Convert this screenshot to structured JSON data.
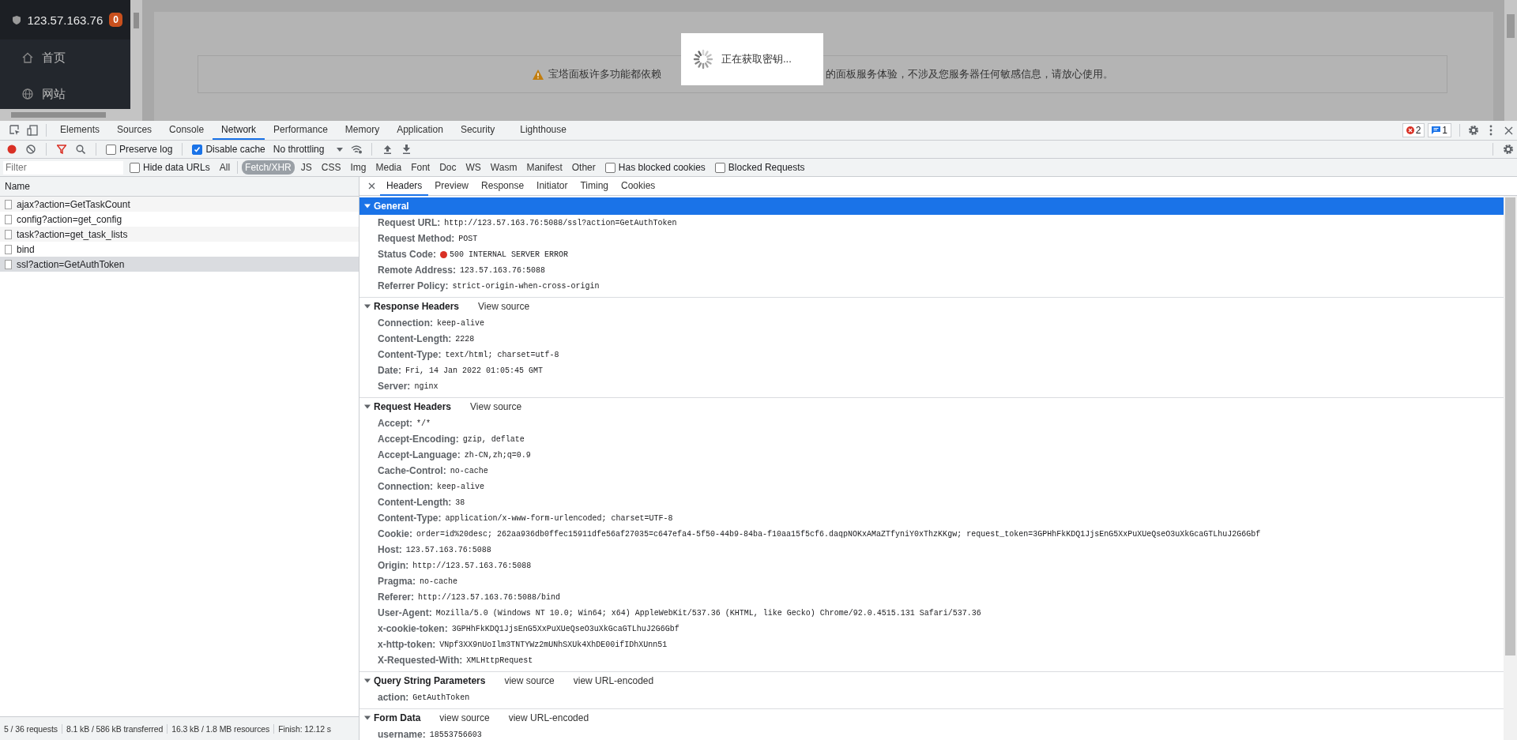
{
  "sidebar": {
    "host": "123.57.163.76",
    "badge": "0",
    "items": [
      {
        "label": "首页"
      },
      {
        "label": "网站"
      }
    ]
  },
  "notice": {
    "text_before": "宝塔面板许多功能都依赖",
    "text_after": "的面板服务体验，不涉及您服务器任何敏感信息，请放心使用。"
  },
  "loading_dialog": {
    "text": "正在获取密钥..."
  },
  "devtools": {
    "tabs": [
      {
        "label": "Elements",
        "selected": false
      },
      {
        "label": "Sources",
        "selected": false
      },
      {
        "label": "Console",
        "selected": false
      },
      {
        "label": "Network",
        "selected": true
      },
      {
        "label": "Performance",
        "selected": false
      },
      {
        "label": "Memory",
        "selected": false
      },
      {
        "label": "Application",
        "selected": false
      },
      {
        "label": "Security",
        "selected": false
      },
      {
        "label": "Lighthouse",
        "selected": false
      }
    ],
    "error_count": "2",
    "message_count": "1",
    "toolbar": {
      "recording": true,
      "filter_active": true,
      "preserve_log": {
        "label": "Preserve log",
        "checked": false
      },
      "disable_cache": {
        "label": "Disable cache",
        "checked": true
      },
      "throttling": "No throttling"
    },
    "filter_bar": {
      "placeholder": "Filter",
      "hide_data_urls": {
        "label": "Hide data URLs",
        "checked": false
      },
      "types": [
        {
          "label": "All",
          "selected": false
        },
        {
          "label": "Fetch/XHR",
          "selected": true
        },
        {
          "label": "JS",
          "selected": false
        },
        {
          "label": "CSS",
          "selected": false
        },
        {
          "label": "Img",
          "selected": false
        },
        {
          "label": "Media",
          "selected": false
        },
        {
          "label": "Font",
          "selected": false
        },
        {
          "label": "Doc",
          "selected": false
        },
        {
          "label": "WS",
          "selected": false
        },
        {
          "label": "Wasm",
          "selected": false
        },
        {
          "label": "Manifest",
          "selected": false
        },
        {
          "label": "Other",
          "selected": false
        }
      ],
      "has_blocked_cookies": {
        "label": "Has blocked cookies",
        "checked": false
      },
      "blocked_requests": {
        "label": "Blocked Requests",
        "checked": false
      }
    },
    "requests": {
      "column": "Name",
      "rows": [
        {
          "name": "ajax?action=GetTaskCount",
          "selected": false
        },
        {
          "name": "config?action=get_config",
          "selected": false
        },
        {
          "name": "task?action=get_task_lists",
          "selected": false
        },
        {
          "name": "bind",
          "selected": false
        },
        {
          "name": "ssl?action=GetAuthToken",
          "selected": true
        }
      ]
    },
    "detail_tabs": [
      {
        "label": "Headers",
        "selected": true
      },
      {
        "label": "Preview",
        "selected": false
      },
      {
        "label": "Response",
        "selected": false
      },
      {
        "label": "Initiator",
        "selected": false
      },
      {
        "label": "Timing",
        "selected": false
      },
      {
        "label": "Cookies",
        "selected": false
      }
    ],
    "sections": [
      {
        "title": "General",
        "expanded": true,
        "selected": true,
        "rows": [
          {
            "key": "Request URL:",
            "value": "http://123.57.163.76:5088/ssl?action=GetAuthToken",
            "kind": "text"
          },
          {
            "key": "Request Method:",
            "value": "POST",
            "kind": "text"
          },
          {
            "key": "Status Code:",
            "value": "500 INTERNAL SERVER ERROR",
            "kind": "error"
          },
          {
            "key": "Remote Address:",
            "value": "123.57.163.76:5088",
            "kind": "text"
          },
          {
            "key": "Referrer Policy:",
            "value": "strict-origin-when-cross-origin",
            "kind": "text"
          }
        ]
      },
      {
        "title": "Response Headers",
        "expanded": true,
        "selected": false,
        "links": [
          "View source"
        ],
        "rows": [
          {
            "key": "Connection:",
            "value": "keep-alive"
          },
          {
            "key": "Content-Length:",
            "value": "2228"
          },
          {
            "key": "Content-Type:",
            "value": "text/html; charset=utf-8"
          },
          {
            "key": "Date:",
            "value": "Fri, 14 Jan 2022 01:05:45 GMT"
          },
          {
            "key": "Server:",
            "value": "nginx"
          }
        ]
      },
      {
        "title": "Request Headers",
        "expanded": true,
        "selected": false,
        "links": [
          "View source"
        ],
        "rows": [
          {
            "key": "Accept:",
            "value": "*/*"
          },
          {
            "key": "Accept-Encoding:",
            "value": "gzip, deflate"
          },
          {
            "key": "Accept-Language:",
            "value": "zh-CN,zh;q=0.9"
          },
          {
            "key": "Cache-Control:",
            "value": "no-cache"
          },
          {
            "key": "Connection:",
            "value": "keep-alive"
          },
          {
            "key": "Content-Length:",
            "value": "38"
          },
          {
            "key": "Content-Type:",
            "value": "application/x-www-form-urlencoded; charset=UTF-8"
          },
          {
            "key": "Cookie:",
            "value": "order=id%20desc; 262aa936db0ffec15911dfe56af27035=c647efa4-5f50-44b9-84ba-f10aa15f5cf6.daqpNOKxAMaZTfyniY0xThzKKgw; request_token=3GPHhFkKDQ1JjsEnG5XxPuXUeQseO3uXkGcaGTLhuJ2G6Gbf"
          },
          {
            "key": "Host:",
            "value": "123.57.163.76:5088"
          },
          {
            "key": "Origin:",
            "value": "http://123.57.163.76:5088"
          },
          {
            "key": "Pragma:",
            "value": "no-cache"
          },
          {
            "key": "Referer:",
            "value": "http://123.57.163.76:5088/bind"
          },
          {
            "key": "User-Agent:",
            "value": "Mozilla/5.0 (Windows NT 10.0; Win64; x64) AppleWebKit/537.36 (KHTML, like Gecko) Chrome/92.0.4515.131 Safari/537.36"
          },
          {
            "key": "x-cookie-token:",
            "value": "3GPHhFkKDQ1JjsEnG5XxPuXUeQseO3uXkGcaGTLhuJ2G6Gbf"
          },
          {
            "key": "x-http-token:",
            "value": "VNpf3XX9nUoIlm3TNTYWz2mUNhSXUk4XhDE00ifIDhXUnn51"
          },
          {
            "key": "X-Requested-With:",
            "value": "XMLHttpRequest"
          }
        ]
      },
      {
        "title": "Query String Parameters",
        "expanded": true,
        "selected": false,
        "links": [
          "view source",
          "view URL-encoded"
        ],
        "rows": [
          {
            "key": "action:",
            "value": "GetAuthToken"
          }
        ]
      },
      {
        "title": "Form Data",
        "expanded": true,
        "selected": false,
        "links": [
          "view source",
          "view URL-encoded"
        ],
        "rows": [
          {
            "key": "username:",
            "value": "18553756603"
          }
        ]
      }
    ],
    "status_bar": [
      "5 / 36 requests",
      "8.1 kB / 586 kB transferred",
      "16.3 kB / 1.8 MB resources",
      "Finish: 12.12 s"
    ]
  }
}
